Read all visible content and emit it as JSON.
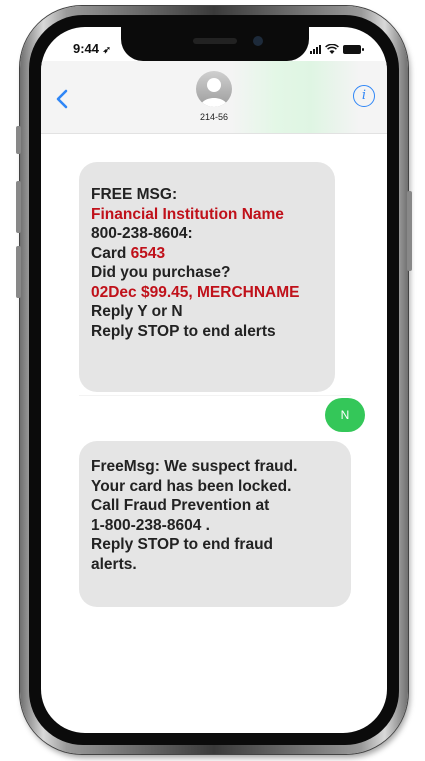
{
  "status_bar": {
    "time": "9:44",
    "location_glyph": "➶",
    "icons": [
      "signal-icon",
      "wifi-icon",
      "battery-icon"
    ]
  },
  "header": {
    "back_icon": "chevron-left-icon",
    "contact_name": "214-56",
    "avatar_icon": "person-silhouette-icon",
    "info_icon": "i"
  },
  "messages": [
    {
      "direction": "received",
      "lines": [
        {
          "text": "FREE MSG:",
          "style": "bold"
        },
        {
          "text": "Financial Institution Name",
          "style": "red"
        },
        {
          "text": "800-238-8604:",
          "style": "bold"
        },
        {
          "prefix": "Card ",
          "highlight": "6543",
          "style": "mixed"
        },
        {
          "text": "Did you purchase?",
          "style": "bold"
        },
        {
          "text": "02Dec $99.45, MERCHNAME",
          "style": "red"
        },
        {
          "text": "Reply Y or N",
          "style": "bold"
        },
        {
          "text": "Reply STOP to end alerts",
          "style": "bold"
        }
      ]
    },
    {
      "direction": "sent",
      "text": "N"
    },
    {
      "direction": "received",
      "lines": [
        {
          "text": "FreeMsg: We suspect fraud."
        },
        {
          "text": "Your card has been locked."
        },
        {
          "text": "Call Fraud Prevention at"
        },
        {
          "text": "1-800-238-8604 ."
        },
        {
          "text": "Reply STOP to end fraud"
        },
        {
          "text": "alerts."
        }
      ]
    }
  ],
  "colors": {
    "received_bubble": "#e5e5e5",
    "sent_bubble": "#34c759",
    "highlight_red": "#c0111a",
    "ios_blue": "#2f86f6"
  }
}
